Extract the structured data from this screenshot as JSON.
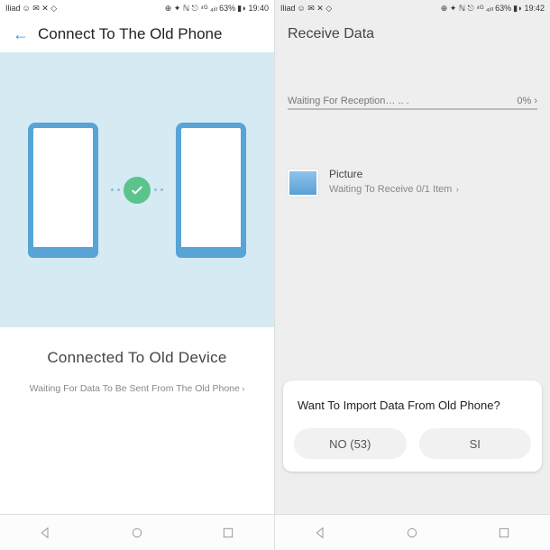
{
  "left": {
    "status": {
      "carrier": "Iliad",
      "icons": "⊕ ✦ ℕ ⎋",
      "battery": "63%",
      "time": "19:40",
      "signal": "📶 ⁴ᴳ ₄ᵢₗₗ"
    },
    "header": {
      "title": "Connect To The Old Phone"
    },
    "info": {
      "title": "Connected To Old Device",
      "subtitle": "Waiting For Data To Be Sent From The Old Phone"
    }
  },
  "right": {
    "status": {
      "carrier": "Iliad",
      "icons": "⊕ ✦ ℕ ⎋",
      "battery": "63%",
      "time": "19:42"
    },
    "header": {
      "title": "Receive Data"
    },
    "progress": {
      "label": "Waiting For Reception… .. .",
      "percent": "0%"
    },
    "item": {
      "title": "Picture",
      "status": "Waiting To Receive 0/1 Item"
    },
    "dialog": {
      "text": "Want To Import Data From Old Phone?",
      "no": "NO (53)",
      "yes": "SI"
    }
  },
  "nav": {
    "back": "◁",
    "home": "○",
    "recents": "□"
  }
}
